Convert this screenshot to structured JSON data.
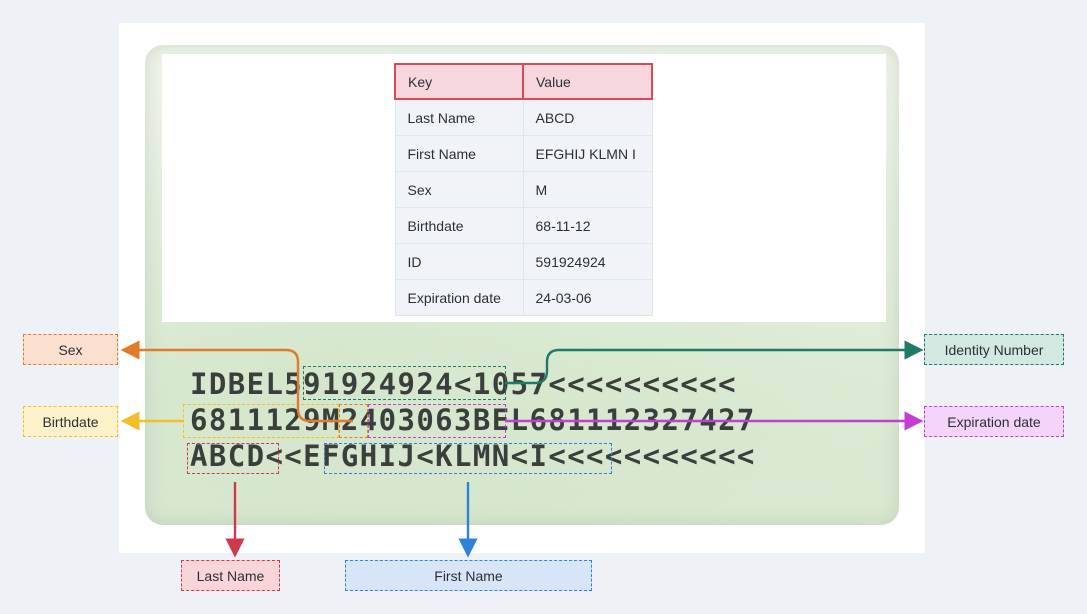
{
  "table": {
    "header": {
      "key": "Key",
      "value": "Value"
    },
    "rows": [
      {
        "key": "Last Name",
        "value": "ABCD"
      },
      {
        "key": "First Name",
        "value": "EFGHIJ KLMN I"
      },
      {
        "key": "Sex",
        "value": "M"
      },
      {
        "key": "Birthdate",
        "value": "68-11-12"
      },
      {
        "key": "ID",
        "value": "591924924"
      },
      {
        "key": "Expiration date",
        "value": "24-03-06"
      }
    ]
  },
  "mrz": {
    "line1": "IDBEL591924924<1057<<<<<<<<<<",
    "line2": "6811129M2403063BEL681112327427",
    "line3": "ABCD<<EFGHIJ<KLMN<I<<<<<<<<<<<"
  },
  "labels": {
    "sex": "Sex",
    "birthdate": "Birthdate",
    "last_name": "Last Name",
    "first_name": "First Name",
    "identity_number": "Identity Number",
    "expiration_date": "Expiration date"
  },
  "colors": {
    "sex": "#e07b2e",
    "birthdate": "#f0bf2a",
    "last_name": "#d0394b",
    "first_name": "#2f83d6",
    "identity_number": "#1f7a66",
    "expiration_date": "#c23fd1",
    "table_header_border": "#d8495c"
  }
}
